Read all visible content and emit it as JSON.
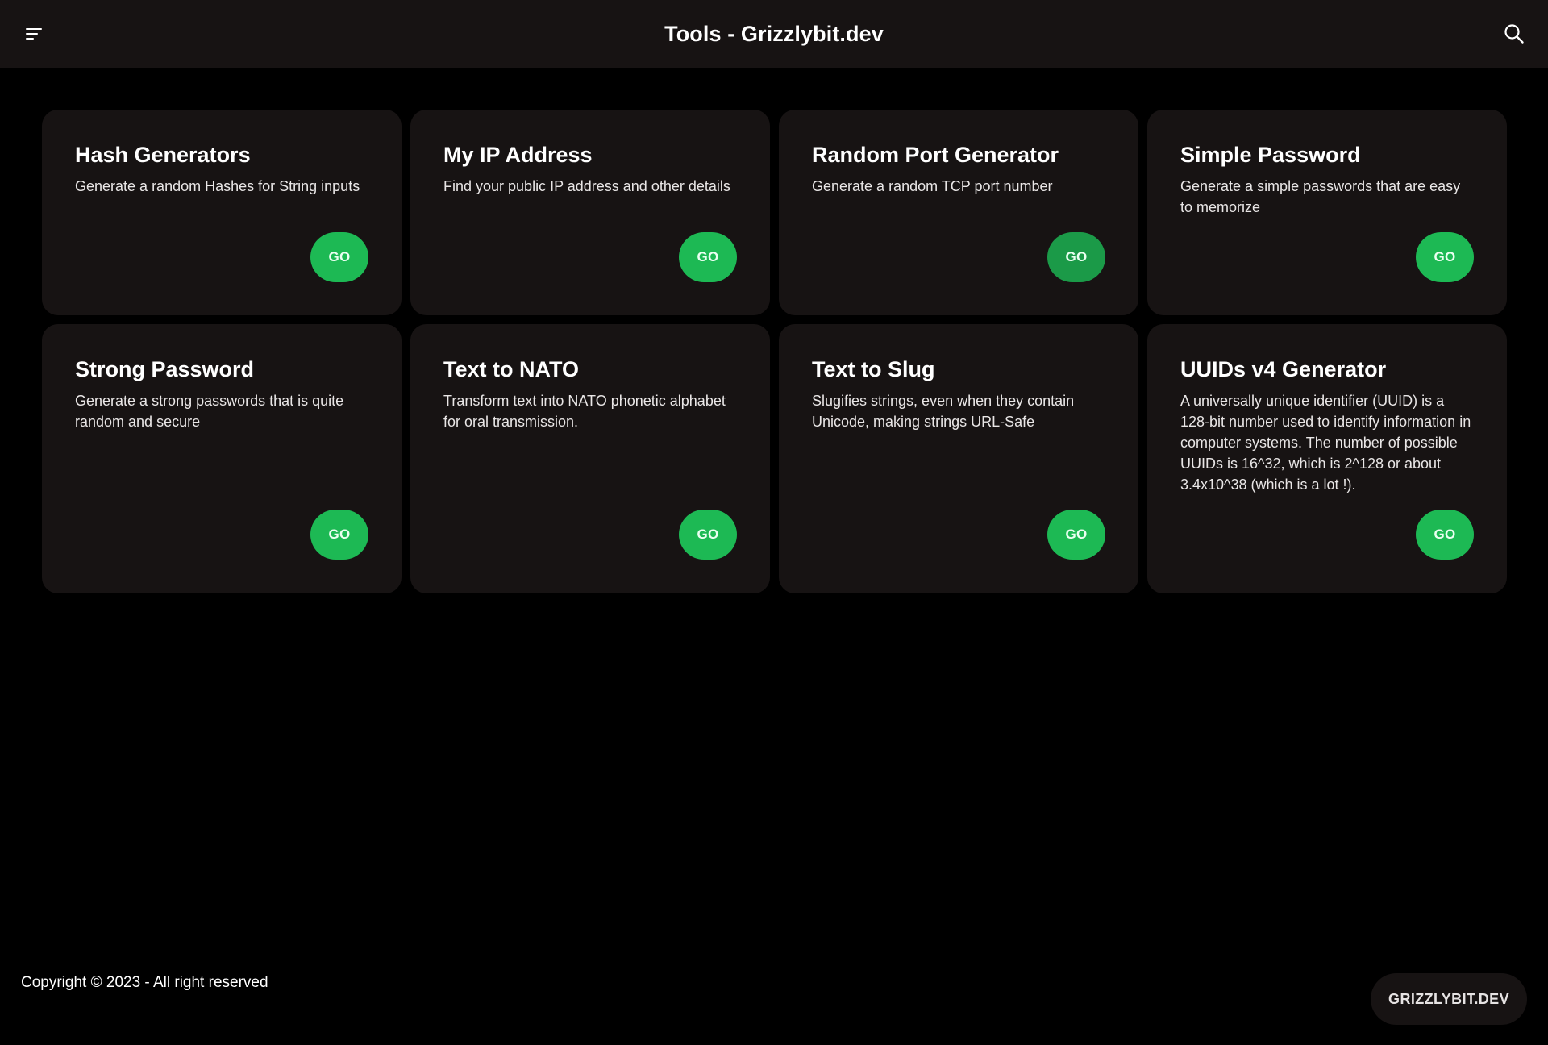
{
  "header": {
    "title": "Tools - Grizzlybit.dev",
    "menu_icon": "hamburger-menu-icon",
    "search_icon": "search-icon"
  },
  "cards": [
    {
      "title": "Hash Generators",
      "description": "Generate a random Hashes for String inputs",
      "button_label": "GO"
    },
    {
      "title": "My IP Address",
      "description": "Find your public IP address and other details",
      "button_label": "GO"
    },
    {
      "title": "Random Port Generator",
      "description": "Generate a random TCP port number",
      "button_label": "GO"
    },
    {
      "title": "Simple Password",
      "description": "Generate a simple passwords that are easy to memorize",
      "button_label": "GO"
    },
    {
      "title": "Strong Password",
      "description": "Generate a strong passwords that is quite random and secure",
      "button_label": "GO"
    },
    {
      "title": "Text to NATO",
      "description": "Transform text into NATO phonetic alphabet for oral transmission.",
      "button_label": "GO"
    },
    {
      "title": "Text to Slug",
      "description": "Slugifies strings, even when they contain Unicode, making strings URL-Safe",
      "button_label": "GO"
    },
    {
      "title": "UUIDs v4 Generator",
      "description": "A universally unique identifier (UUID) is a 128-bit number used to identify information in computer systems. The number of possible UUIDs is 16^32, which is 2^128 or about 3.4x10^38 (which is a lot !).",
      "button_label": "GO"
    }
  ],
  "footer": {
    "copyright": "Copyright © 2023 - All right reserved",
    "brand_label": "GRIZZLYBIT.DEV"
  },
  "colors": {
    "background": "#000000",
    "surface": "#171313",
    "accent": "#1db954",
    "accent_hover": "#1b9a48"
  }
}
